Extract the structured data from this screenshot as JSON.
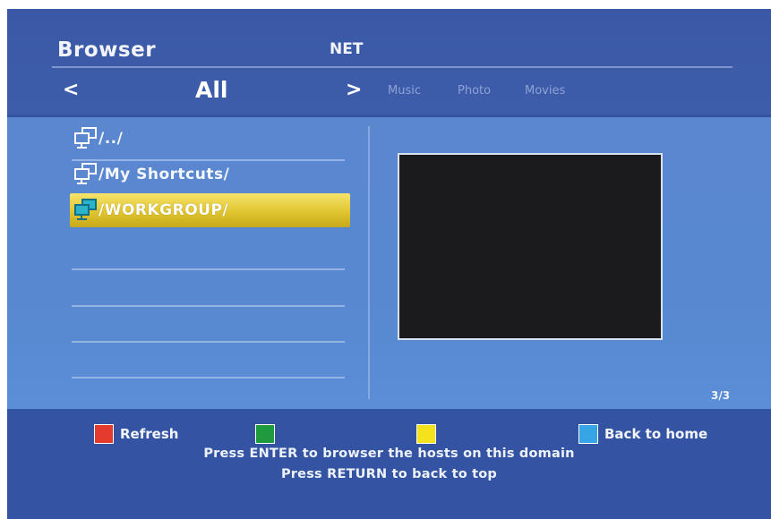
{
  "header": {
    "title": "Browser",
    "source": "NET",
    "prev_arrow": "<",
    "next_arrow": ">",
    "current_category": "All",
    "categories": [
      "Music",
      "Photo",
      "Movies"
    ]
  },
  "file_list": {
    "items": [
      {
        "label": "/../",
        "icon": "network-computer-icon",
        "selected": false
      },
      {
        "label": "/My Shortcuts/",
        "icon": "network-computer-icon",
        "selected": false
      },
      {
        "label": "/WORKGROUP/",
        "icon": "network-computer-icon",
        "selected": true
      }
    ]
  },
  "preview": {
    "page_indicator": "3/3"
  },
  "footer": {
    "buttons": [
      {
        "label": "Refresh",
        "color": "#e53a2e"
      },
      {
        "label": "",
        "color": "#1f9a3f"
      },
      {
        "label": "",
        "color": "#f3e21c"
      },
      {
        "label": "Back to home",
        "color": "#35a5e6"
      }
    ],
    "hint_line1": "Press ENTER to browser the hosts on this domain",
    "hint_line2": "Press RETURN to back to top"
  },
  "colors": {
    "background": "#3f5fab",
    "main_panel": "#5788d0",
    "selection": "#e0c52f"
  }
}
